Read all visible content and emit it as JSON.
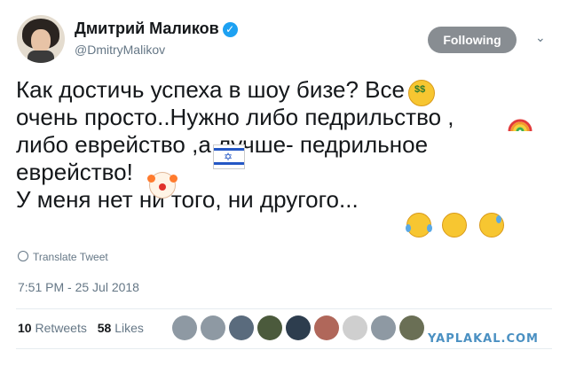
{
  "author": {
    "name": "Дмитрий Маликов",
    "handle": "@DmitryMalikov"
  },
  "follow_button": {
    "label": "Following"
  },
  "tweet": {
    "text": "Как достичь успеха в шоу бизе?       Все\nочень просто..Нужно либо педрильство     ,\nлибо еврейство      ,а лучше- педрильное\nеврейство!   \nУ меня нет ни того, ни другого...",
    "emojis": [
      "money-mouth-face-icon",
      "rainbow-icon",
      "israel-flag-icon",
      "clown-face-icon",
      "tears-of-joy-icon",
      "weary-face-icon",
      "sweat-smile-icon"
    ]
  },
  "translate_link": "Translate Tweet",
  "timestamp": "7:51 PM - 25 Jul 2018",
  "stats": {
    "retweets_count": "10",
    "retweets_label": "Retweets",
    "likes_count": "58",
    "likes_label": "Likes"
  },
  "likers_colors": [
    "#8e99a3",
    "#8e99a3",
    "#5a6b7d",
    "#4b5a3c",
    "#2d3d4e",
    "#b0675a",
    "#cfcfcf",
    "#8e99a3",
    "#6a6f55"
  ],
  "watermark": "YAPLAKAL.COM",
  "colors": {
    "verified": "#1da1f2",
    "follow_button": "#888d92",
    "watermark": "#4a90c2"
  }
}
